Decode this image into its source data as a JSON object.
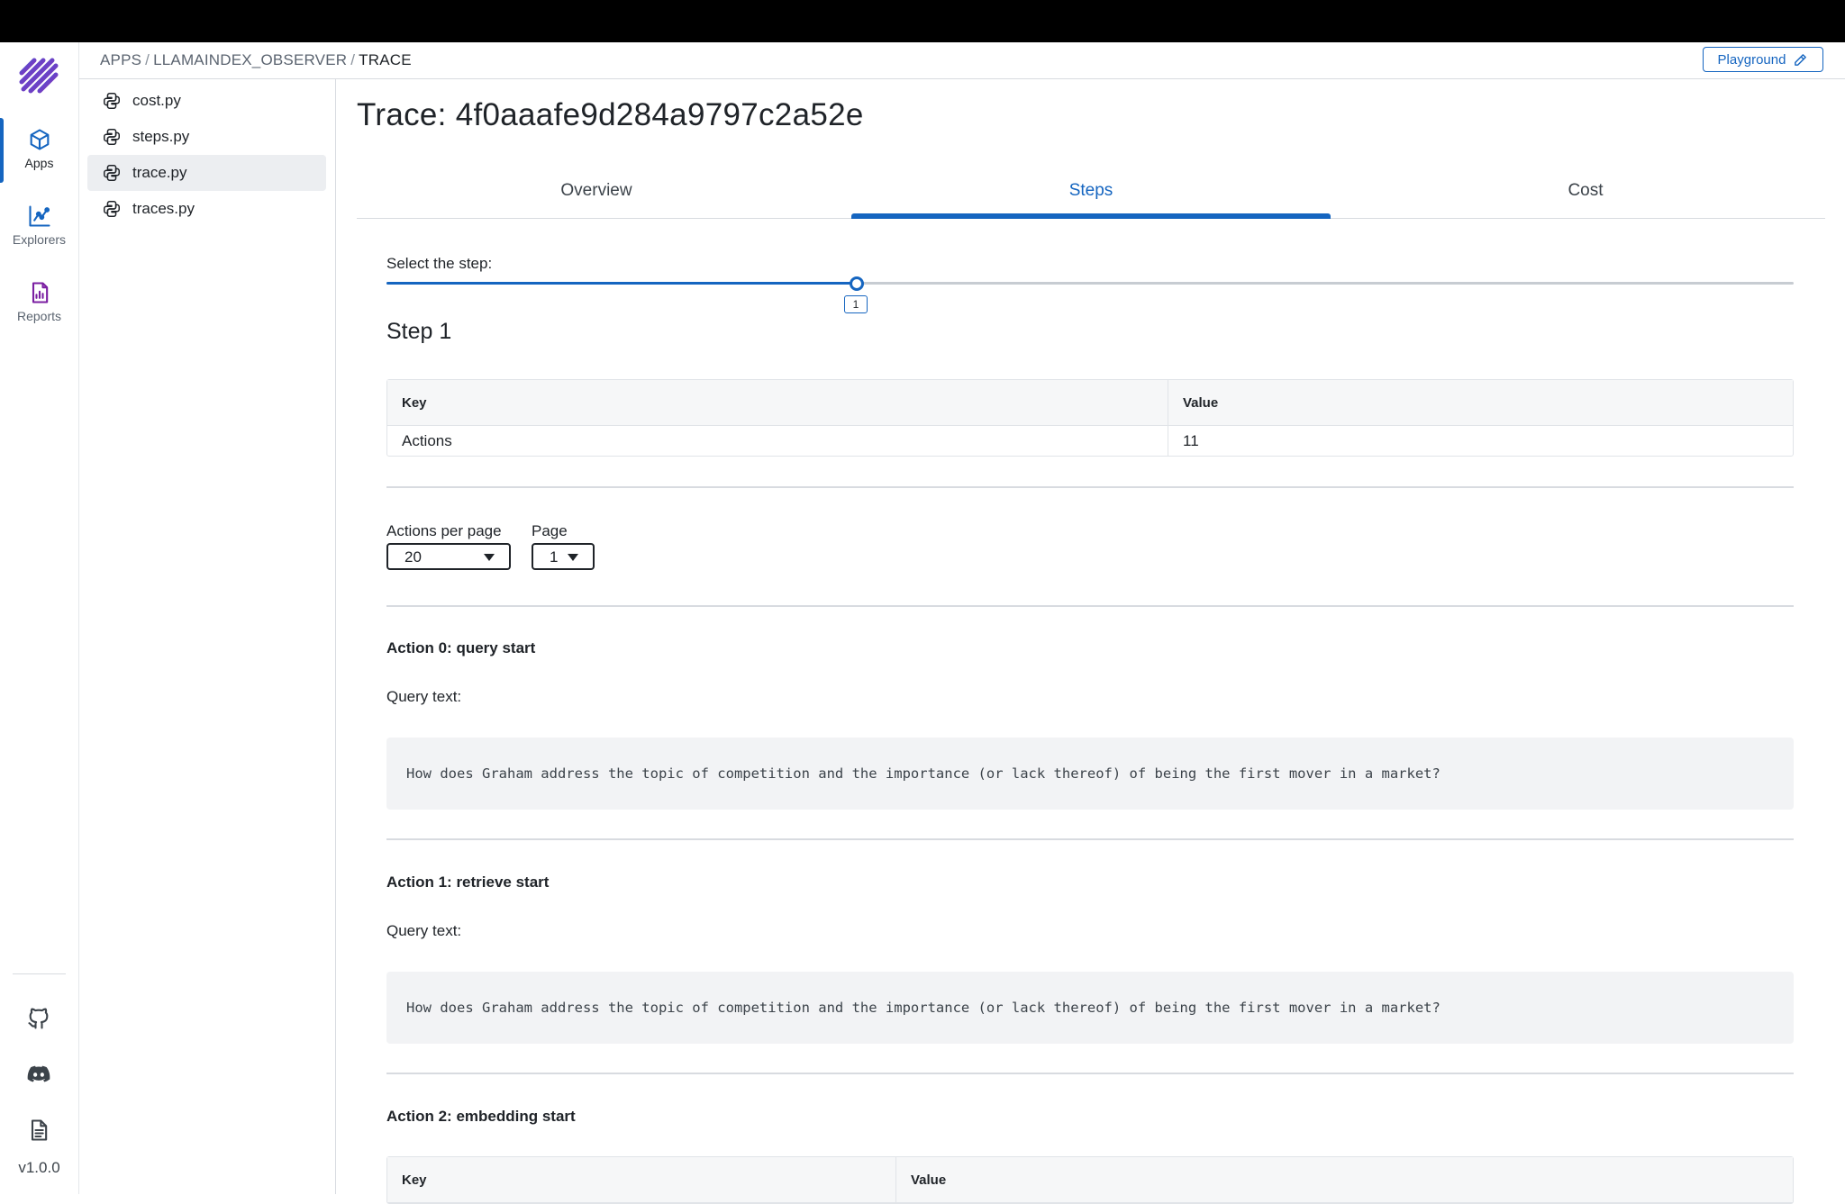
{
  "rail": {
    "items": [
      {
        "label": "Apps",
        "icon": "cube-icon"
      },
      {
        "label": "Explorers",
        "icon": "chart-line-icon"
      },
      {
        "label": "Reports",
        "icon": "report-icon"
      }
    ],
    "version": "v1.0.0"
  },
  "header": {
    "breadcrumb": [
      "APPS",
      "LLAMAINDEX_OBSERVER",
      "TRACE"
    ],
    "playground_label": "Playground"
  },
  "files": [
    {
      "name": "cost.py",
      "active": false
    },
    {
      "name": "steps.py",
      "active": false
    },
    {
      "name": "trace.py",
      "active": true
    },
    {
      "name": "traces.py",
      "active": false
    }
  ],
  "main": {
    "title": "Trace: 4f0aaafe9d284a9797c2a52e",
    "tabs": [
      {
        "label": "Overview",
        "active": false
      },
      {
        "label": "Steps",
        "active": true
      },
      {
        "label": "Cost",
        "active": false
      }
    ],
    "step_selector": {
      "label": "Select the step:",
      "value": "1",
      "fraction": 0.3345
    },
    "step_heading": "Step 1",
    "step_table": {
      "headers": [
        "Key",
        "Value"
      ],
      "rows": [
        [
          "Actions",
          "11"
        ]
      ]
    },
    "pagination": {
      "per_page_label": "Actions per page",
      "per_page_value": "20",
      "page_label": "Page",
      "page_value": "1"
    },
    "actions": [
      {
        "title": "Action 0: query start",
        "query_label": "Query text:",
        "query_text": "How does Graham address the topic of competition and the importance (or lack thereof) of being the first mover in a market?"
      },
      {
        "title": "Action 1: retrieve start",
        "query_label": "Query text:",
        "query_text": "How does Graham address the topic of competition and the importance (or lack thereof) of being the first mover in a market?"
      },
      {
        "title": "Action 2: embedding start",
        "table_headers": [
          "Key",
          "Value"
        ]
      }
    ]
  },
  "colors": {
    "accent": "#1565c0",
    "topbar": "#000000"
  }
}
